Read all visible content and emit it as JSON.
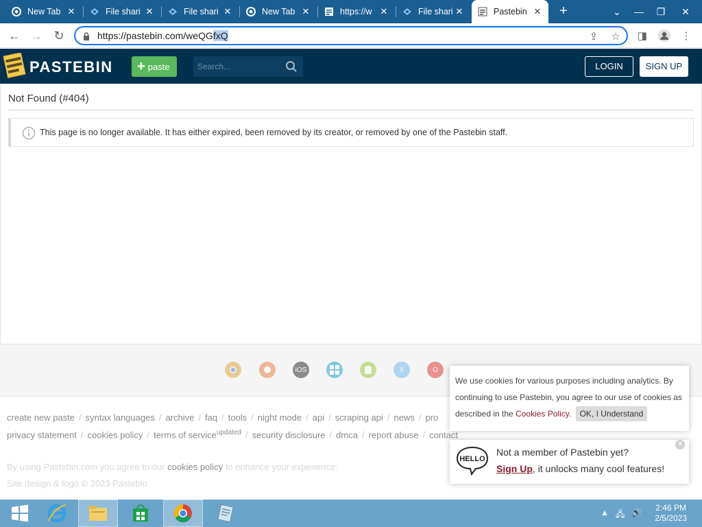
{
  "browser": {
    "tabs": [
      {
        "title": "New Tab",
        "icon": "chrome-icon"
      },
      {
        "title": "File shari",
        "icon": "file-share-icon"
      },
      {
        "title": "File shari",
        "icon": "file-share-icon"
      },
      {
        "title": "New Tab",
        "icon": "chrome-icon"
      },
      {
        "title": "https://w",
        "icon": "page-icon"
      },
      {
        "title": "File shari",
        "icon": "file-share-icon"
      },
      {
        "title": "Pastebin",
        "icon": "pastebin-icon",
        "active": true
      }
    ],
    "url_prefix": "https://pastebin.com/weQG",
    "url_selected": "fxQ"
  },
  "site": {
    "brand": "PASTEBIN",
    "paste_label": "paste",
    "search_placeholder": "Search...",
    "login_label": "LOGIN",
    "signup_label": "SIGN UP",
    "colors": {
      "header": "#02304f",
      "paste_button": "#5bb85d",
      "accent_link": "#8b1e2d"
    }
  },
  "main": {
    "title": "Not Found (#404)",
    "message": "This page is no longer available. It has either expired, been removed by its creator, or removed by one of the Pastebin staff."
  },
  "footer": {
    "apps": [
      {
        "icon": "chrome-app-icon",
        "label": ""
      },
      {
        "icon": "firefox-app-icon",
        "label": ""
      },
      {
        "icon": "ios-app-icon",
        "label": "iOS"
      },
      {
        "icon": "windows-app-icon",
        "label": ""
      },
      {
        "icon": "android-app-icon",
        "label": ""
      },
      {
        "icon": "x-app-icon",
        "label": "X"
      },
      {
        "icon": "opera-app-icon",
        "label": "O"
      }
    ],
    "links_row1": [
      "create new paste",
      "syntax languages",
      "archive",
      "faq",
      "tools",
      "night mode",
      "api",
      "scraping api",
      "news",
      "pro"
    ],
    "links_row2": [
      "privacy statement",
      "cookies policy",
      "terms of service",
      "security disclosure",
      "dmca",
      "report abuse",
      "contact"
    ],
    "updated_badge": "updated",
    "note_before": "By using Pastebin.com you agree to our ",
    "note_link": "cookies policy",
    "note_after": " to enhance your experience.",
    "copyright": "Site design & logo © 2023 Pastebin"
  },
  "cookie": {
    "text": "We use cookies for various purposes including analytics. By continuing to use Pastebin, you agree to our use of cookies as described in the ",
    "link": "Cookies Policy",
    "period": ".",
    "button": "OK, I Understand"
  },
  "signup_popup": {
    "question": "Not a member of Pastebin yet?",
    "cta": "Sign Up",
    "rest": ", it unlocks many cool features!",
    "logo_text": "HELLO"
  },
  "taskbar": {
    "time": "2:46 PM",
    "date": "2/5/2023"
  }
}
